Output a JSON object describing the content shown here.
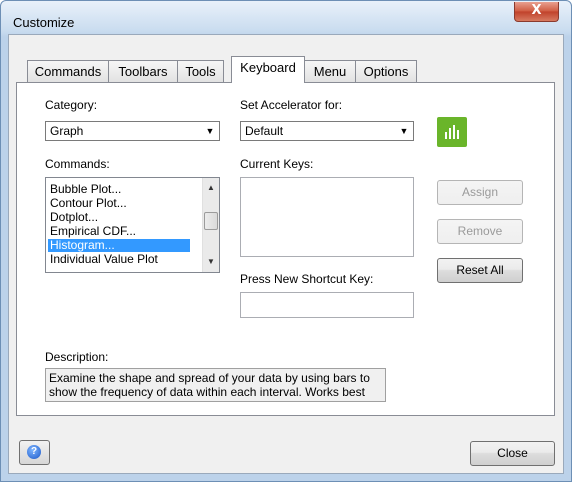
{
  "window": {
    "title": "Customize",
    "close_glyph": "X"
  },
  "tabs": [
    "Commands",
    "Toolbars",
    "Tools",
    "Keyboard",
    "Menu",
    "Options"
  ],
  "active_tab": "Keyboard",
  "category": {
    "label": "Category:",
    "value": "Graph"
  },
  "accelerator": {
    "label": "Set Accelerator for:",
    "value": "Default"
  },
  "commands": {
    "label": "Commands:",
    "items": [
      "Bubble Plot...",
      "Contour Plot...",
      "Dotplot...",
      "Empirical CDF...",
      "Histogram...",
      "Individual Value Plot"
    ],
    "selected": "Histogram..."
  },
  "current_keys": {
    "label": "Current Keys:"
  },
  "new_shortcut": {
    "label": "Press New Shortcut Key:",
    "value": ""
  },
  "buttons": {
    "assign": "Assign",
    "remove": "Remove",
    "reset_all": "Reset All",
    "close": "Close"
  },
  "description": {
    "label": "Description:",
    "text": "Examine the shape and spread of your data by using bars to show the frequency of data within each interval. Works best"
  },
  "icons": {
    "graph_icon": "bar-chart-icon",
    "help_icon": "help-icon"
  },
  "colors": {
    "graph_icon_bg": "#6ab52a",
    "selection": "#3399ff",
    "close_button": "#c0412a"
  }
}
